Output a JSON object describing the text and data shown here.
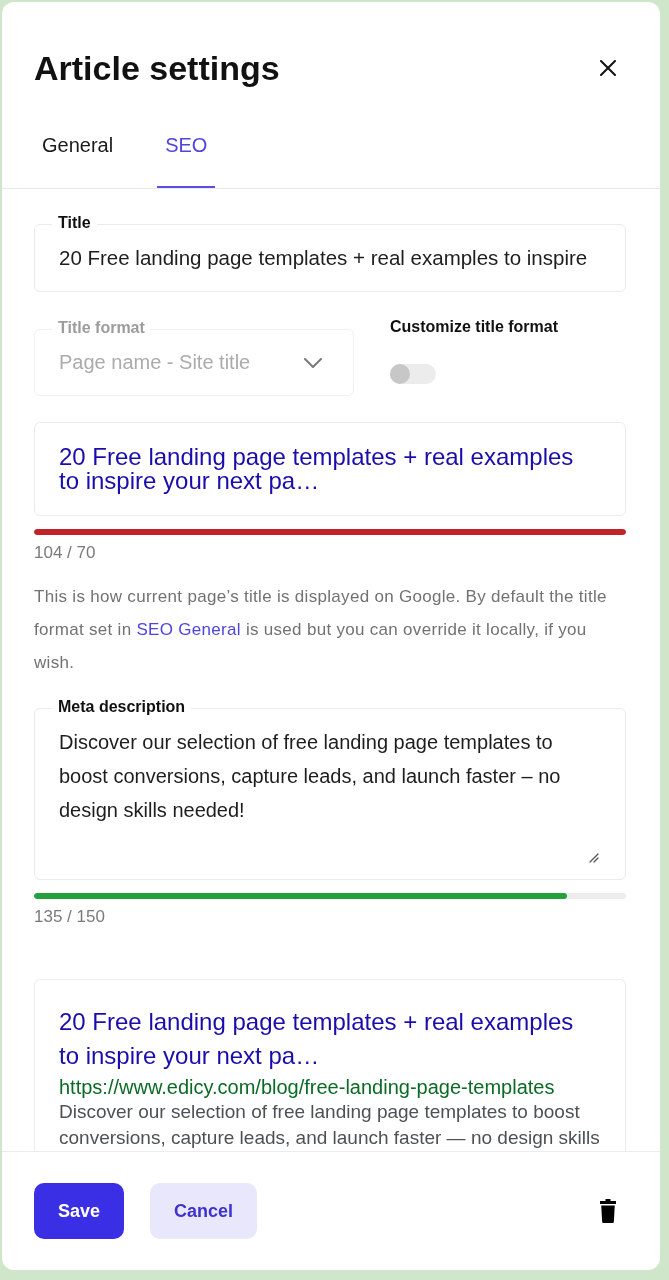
{
  "header": {
    "title": "Article settings"
  },
  "tabs": [
    {
      "label": "General",
      "selected": false
    },
    {
      "label": "SEO",
      "selected": true
    }
  ],
  "title_field": {
    "label": "Title",
    "value": "20 Free landing page templates + real examples to inspire"
  },
  "title_format": {
    "label": "Title format",
    "value": "Page name - Site title",
    "disabled": true
  },
  "customize_title_format": {
    "label": "Customize title format",
    "on": false
  },
  "title_preview": {
    "text": "20 Free landing page templates + real examples to inspire your next pa…"
  },
  "title_length": {
    "level": 1,
    "over_limit": true,
    "count": "104 / 70"
  },
  "help_text": {
    "before": "This is how current page’s title is displayed on Google. By default the title format set in ",
    "link": "SEO General",
    "after": " is used but you can override it locally, if you wish."
  },
  "meta_description": {
    "label": "Meta description",
    "value": "Discover our selection of free landing page templates to boost conversions, capture leads, and launch faster – no design skills needed!"
  },
  "description_length": {
    "level": 0.9,
    "over_limit": false,
    "count": "135 / 150"
  },
  "search_preview": {
    "title": "20 Free landing page templates + real examples to inspire your next pa…",
    "url": "https://www.edicy.com/blog/free-landing-page-templates",
    "description": "Discover our selection of free landing page templates to boost conversions, capture leads, and launch faster — no design skills"
  },
  "footer": {
    "buttons": [
      {
        "label": "Save",
        "kind": "primary"
      },
      {
        "label": "Cancel",
        "kind": "secondary"
      }
    ]
  }
}
